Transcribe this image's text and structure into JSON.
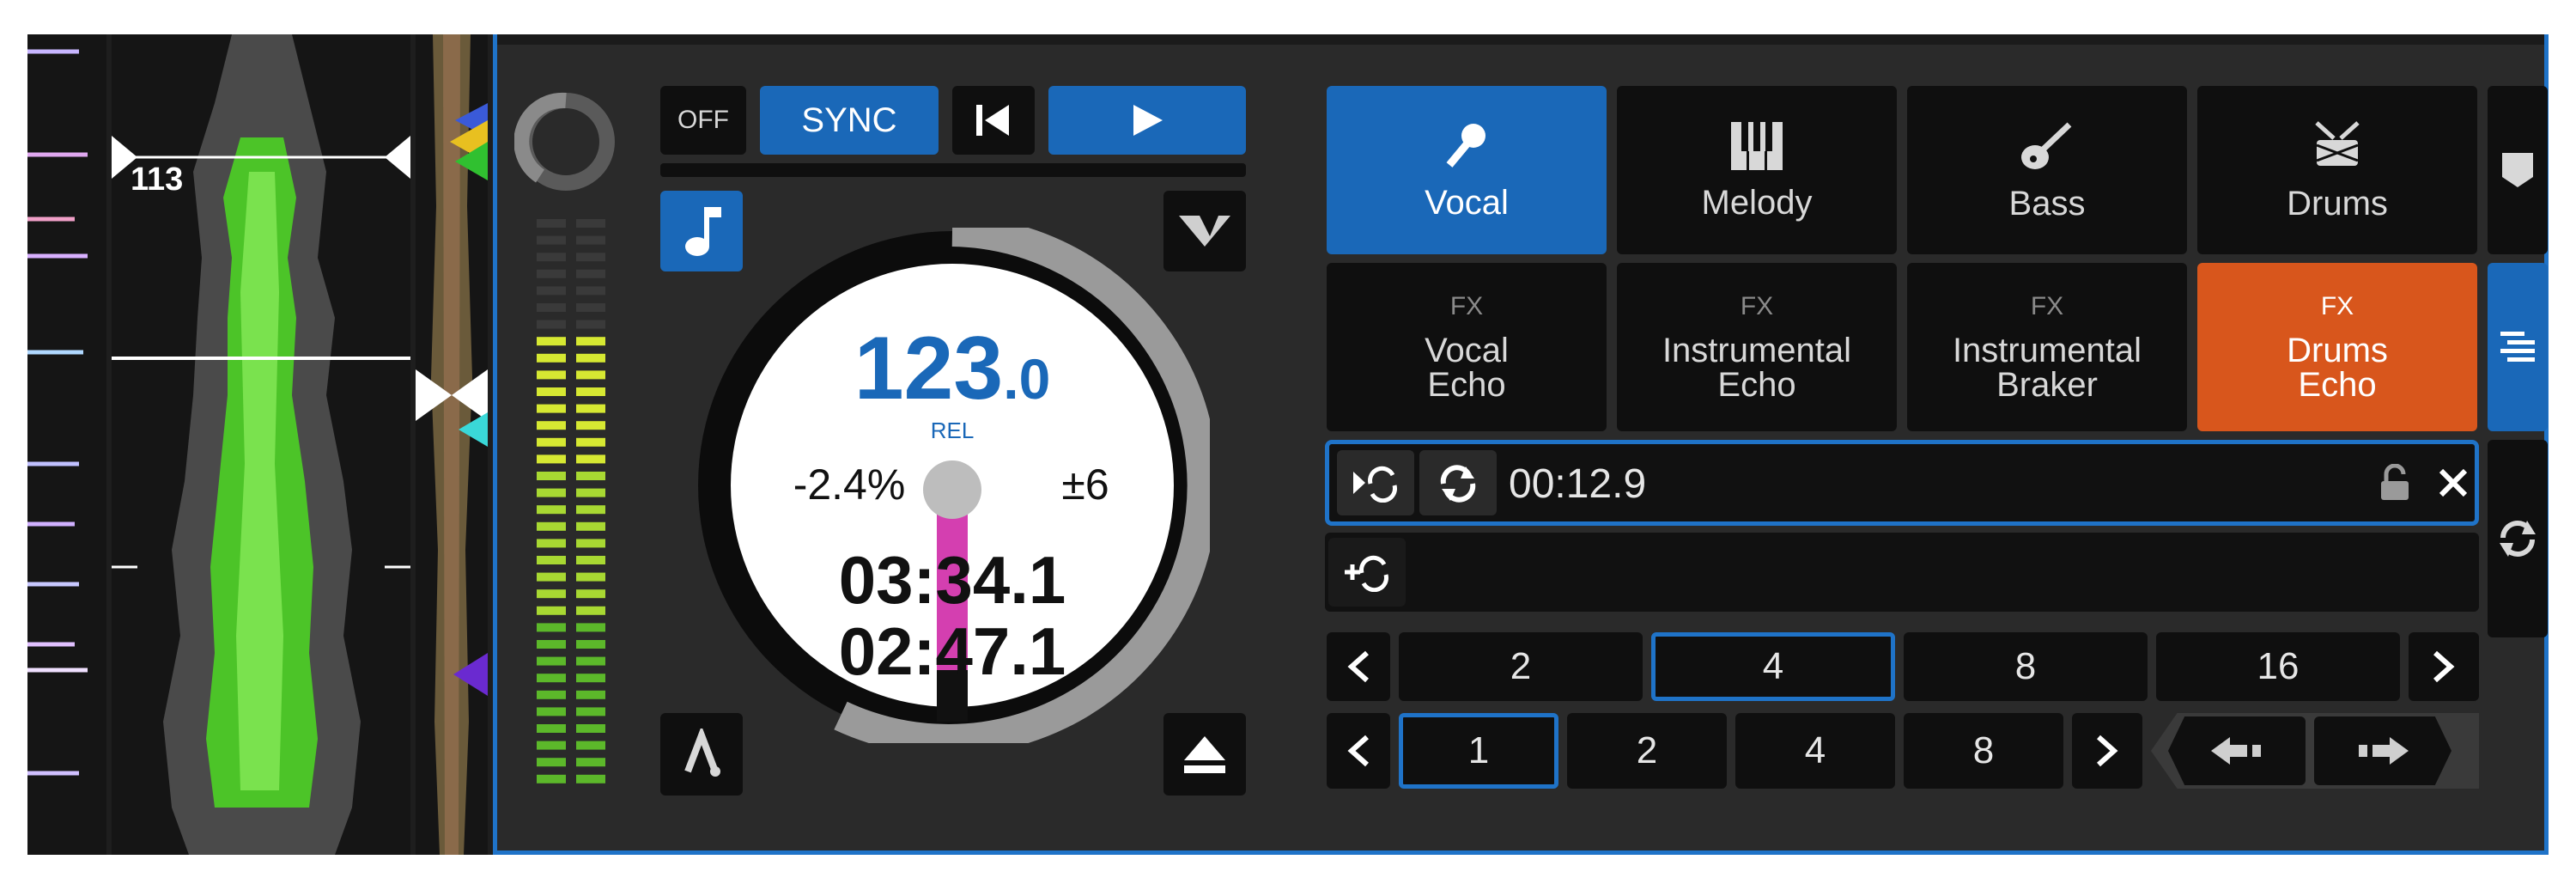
{
  "colors": {
    "accent_blue": "#1a68b8",
    "orange": "#d8561c",
    "waveform_green": "#5fd23a",
    "needle_magenta": "#d43fb0"
  },
  "waveform": {
    "beat_counter": "113"
  },
  "transport": {
    "off_label": "OFF",
    "sync_label": "SYNC",
    "cue_icon": "skip-to-start-icon",
    "play_icon": "play-icon"
  },
  "disc": {
    "bpm_main": "123",
    "bpm_decimal": ".0",
    "rel_label": "REL",
    "pitch": "-2.4%",
    "pitch_range": "±6",
    "time_remaining": "03:34.1",
    "time_elapsed": "02:47.1"
  },
  "stem_pads": [
    {
      "label": "Vocal",
      "icon": "microphone-icon",
      "active": true
    },
    {
      "label": "Melody",
      "icon": "piano-keys-icon",
      "active": false
    },
    {
      "label": "Bass",
      "icon": "guitar-icon",
      "active": false
    },
    {
      "label": "Drums",
      "icon": "drum-icon",
      "active": false
    }
  ],
  "fx_pads": [
    {
      "fx": "FX",
      "line1": "Vocal",
      "line2": "Echo",
      "active": false
    },
    {
      "fx": "FX",
      "line1": "Instrumental",
      "line2": "Echo",
      "active": false
    },
    {
      "fx": "FX",
      "line1": "Instrumental",
      "line2": "Braker",
      "active": false
    },
    {
      "fx": "FX",
      "line1": "Drums",
      "line2": "Echo",
      "active": true
    }
  ],
  "loop": {
    "time": "00:12.9"
  },
  "loop_sizes_row1": {
    "values": [
      "2",
      "4",
      "8",
      "16"
    ],
    "selected": "4"
  },
  "loop_sizes_row2": {
    "values": [
      "1",
      "2",
      "4",
      "8"
    ],
    "selected": "1"
  }
}
